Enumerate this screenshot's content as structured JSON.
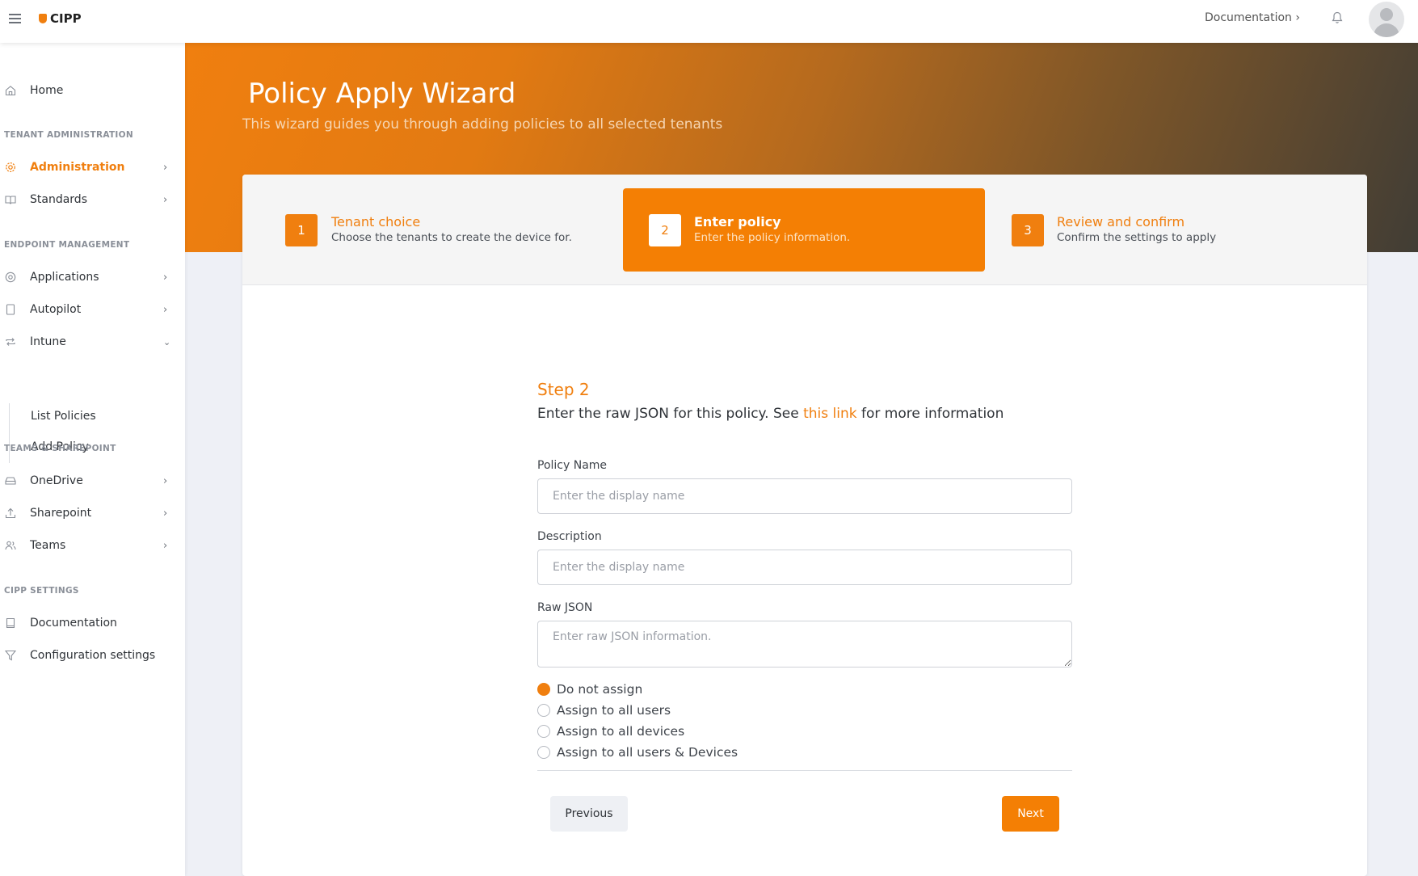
{
  "header": {
    "app_name": "CIPP",
    "documentation_link": "Documentation ›"
  },
  "sidebar": {
    "home": "Home",
    "sections": {
      "tenant_admin": "TENANT ADMINISTRATION",
      "endpoint": "ENDPOINT MANAGEMENT",
      "teams_sharepoint": "TEAMS & SHAREPOINT",
      "settings": "CIPP SETTINGS"
    },
    "items": {
      "administration": "Administration",
      "standards": "Standards",
      "applications": "Applications",
      "autopilot": "Autopilot",
      "intune": "Intune",
      "list_policies": "List Policies",
      "add_policy": "Add Policy",
      "onedrive": "OneDrive",
      "sharepoint": "Sharepoint",
      "teams": "Teams",
      "documentation": "Documentation",
      "configuration": "Configuration settings"
    }
  },
  "hero": {
    "title": "Policy Apply Wizard",
    "subtitle": "This wizard guides you through adding policies to all selected tenants"
  },
  "steps": [
    {
      "number": "1",
      "title": "Tenant choice",
      "desc": "Choose the tenants to create the device for."
    },
    {
      "number": "2",
      "title": "Enter policy",
      "desc": "Enter the policy information."
    },
    {
      "number": "3",
      "title": "Review and confirm",
      "desc": "Confirm the settings to apply"
    }
  ],
  "form": {
    "step_heading": "Step 2",
    "instruction_before": "Enter the raw JSON for this policy. See ",
    "instruction_link": "this link",
    "instruction_after": " for more information",
    "policy_name_label": "Policy Name",
    "policy_name_placeholder": "Enter the display name",
    "description_label": "Description",
    "description_placeholder": "Enter the display name",
    "raw_json_label": "Raw JSON",
    "raw_json_placeholder": "Enter raw JSON information.",
    "radio_options": [
      {
        "label": "Do not assign",
        "checked": true
      },
      {
        "label": "Assign to all users",
        "checked": false
      },
      {
        "label": "Assign to all devices",
        "checked": false
      },
      {
        "label": "Assign to all users & Devices",
        "checked": false
      }
    ],
    "previous_label": "Previous",
    "next_label": "Next"
  },
  "colors": {
    "accent": "#f07f0f",
    "active_step": "#f47f04"
  }
}
